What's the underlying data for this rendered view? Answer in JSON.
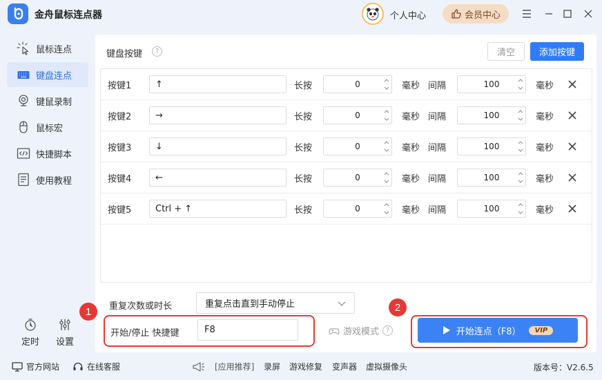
{
  "app": {
    "title": "金舟鼠标连点器",
    "user_center": "个人中心",
    "vip_center": "会员中心"
  },
  "sidebar": {
    "items": [
      {
        "label": "鼠标连点",
        "icon": "cursor-click-icon"
      },
      {
        "label": "键盘连点",
        "icon": "keyboard-icon",
        "active": true
      },
      {
        "label": "键鼠录制",
        "icon": "webcam-icon"
      },
      {
        "label": "鼠标宏",
        "icon": "mouse-icon"
      },
      {
        "label": "快捷脚本",
        "icon": "code-icon"
      },
      {
        "label": "使用教程",
        "icon": "document-icon"
      }
    ],
    "timer_label": "定时",
    "settings_label": "设置"
  },
  "keyboard": {
    "section_title": "键盘按键",
    "help_icon": "?",
    "clear_label": "清空",
    "add_label": "添加按键",
    "hold_label": "长按",
    "ms_label": "毫秒",
    "interval_label": "间隔",
    "rows": [
      {
        "name": "按键1",
        "key": "↑",
        "hold": "0",
        "interval": "100"
      },
      {
        "name": "按键2",
        "key": "→",
        "hold": "0",
        "interval": "100"
      },
      {
        "name": "按键3",
        "key": "↓",
        "hold": "0",
        "interval": "100"
      },
      {
        "name": "按键4",
        "key": "←",
        "hold": "0",
        "interval": "100"
      },
      {
        "name": "按键5",
        "key": "Ctrl + ↑",
        "hold": "0",
        "interval": "100"
      }
    ]
  },
  "controls": {
    "repeat_label": "重复次数或时长",
    "repeat_value": "重复点击直到手动停止",
    "hotkey_label": "开始/停止 快捷键",
    "hotkey_value": "F8",
    "game_mode_label": "游戏模式",
    "start_label": "开始连点（F8）",
    "vip_tag": "VIP",
    "badge_1": "1",
    "badge_2": "2"
  },
  "footer": {
    "official_site": "官方网站",
    "online_support": "在线客服",
    "recommend": "[应用推荐]",
    "links": [
      "录屏",
      "游戏修复",
      "变声器",
      "虚拟摄像头"
    ],
    "version": "版本号：V2.6.5"
  },
  "colors": {
    "accent": "#2f7cf6",
    "highlight_border": "#e53935",
    "vip_bg": "#f5ddc4"
  }
}
